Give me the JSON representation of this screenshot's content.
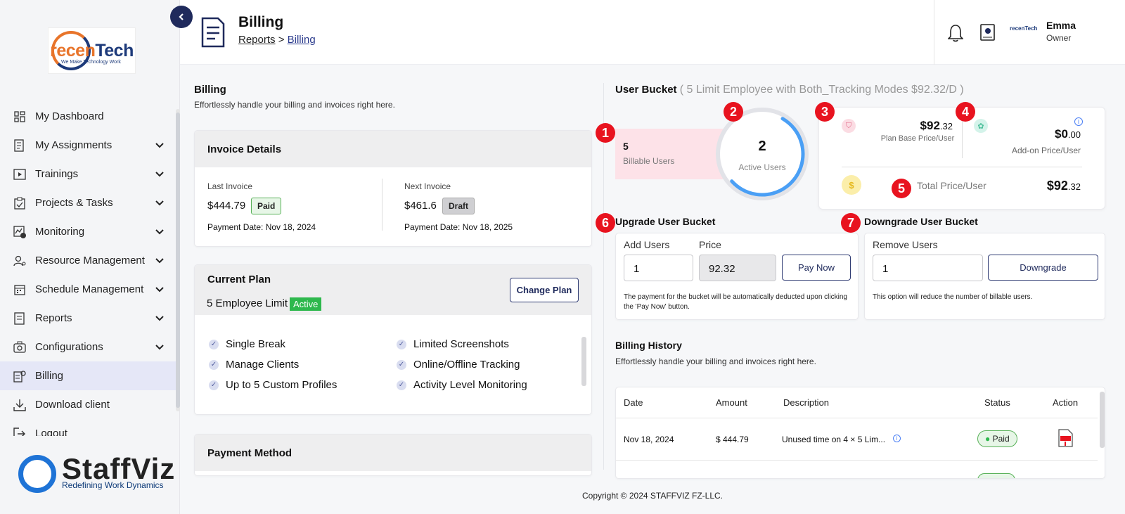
{
  "sidebar": {
    "brand": {
      "name_c": "recen",
      "name_t": "Tech",
      "tagline": "We Make Technology Work"
    },
    "items": [
      {
        "label": "My Dashboard",
        "icon": "dashboard-icon",
        "chevron": false
      },
      {
        "label": "My Assignments",
        "icon": "assignments-icon",
        "chevron": true
      },
      {
        "label": "Trainings",
        "icon": "play-icon",
        "chevron": true
      },
      {
        "label": "Projects & Tasks",
        "icon": "clipboard-icon",
        "chevron": true
      },
      {
        "label": "Monitoring",
        "icon": "monitor-icon",
        "chevron": true
      },
      {
        "label": "Resource Management",
        "icon": "user-gear-icon",
        "chevron": true
      },
      {
        "label": "Schedule Management",
        "icon": "calendar-icon",
        "chevron": true
      },
      {
        "label": "Reports",
        "icon": "report-icon",
        "chevron": true
      },
      {
        "label": "Configurations",
        "icon": "config-icon",
        "chevron": true
      },
      {
        "label": "Billing",
        "icon": "billing-icon",
        "chevron": false,
        "active": true
      },
      {
        "label": "Download client",
        "icon": "download-icon",
        "chevron": false
      },
      {
        "label": "Logout",
        "icon": "logout-icon",
        "chevron": false
      }
    ],
    "footer_brand": {
      "name": "StaffViz",
      "tagline": "Redefining Work Dynamics"
    }
  },
  "header": {
    "title": "Billing",
    "breadcrumb": [
      "Reports",
      "Billing"
    ],
    "user_name": "Emma",
    "user_role": "Owner",
    "avatar_text": "recenTech"
  },
  "billing": {
    "title": "Billing",
    "subtitle": "Effortlessly handle your billing and invoices right here."
  },
  "invoice": {
    "title": "Invoice Details",
    "last_label": "Last Invoice",
    "last_amount": "$444.79",
    "last_status": "Paid",
    "last_date": "Payment Date: Nov 18, 2024",
    "next_label": "Next Invoice",
    "next_amount": "$461.6",
    "next_status": "Draft",
    "next_date": "Payment Date: Nov 18, 2025"
  },
  "plan": {
    "title": "Current Plan",
    "name": "5 Employee Limit",
    "status": "Active",
    "change_label": "Change Plan",
    "features": [
      "Single Break",
      "Limited Screenshots",
      "Manage Clients",
      "Online/Offline Tracking",
      "Up to 5 Custom Profiles",
      "Activity Level Monitoring"
    ]
  },
  "payment_method": {
    "title": "Payment Method"
  },
  "bucket": {
    "title": "User Bucket",
    "subtitle": "( 5 Limit Employee with Both_Tracking Modes $92.32/D )",
    "billable_count": "5",
    "billable_label": "Billable Users",
    "active_count": "2",
    "active_label": "Active Users",
    "active_ratio": 0.55,
    "base_price_main": "$92",
    "base_price_dec": ".32",
    "base_price_label": "Plan Base Price/User",
    "addon_price_main": "$0",
    "addon_price_dec": ".00",
    "addon_price_label": "Add-on Price/User",
    "total_label": "Total Price/User",
    "total_main": "$92",
    "total_dec": ".32",
    "markers": [
      "1",
      "2",
      "3",
      "4",
      "5",
      "6",
      "7"
    ]
  },
  "upgrade": {
    "title": "Upgrade User Bucket",
    "add_label": "Add Users",
    "add_value": "1",
    "price_label": "Price",
    "price_value": "92.32",
    "pay_label": "Pay Now",
    "note": "The payment for the bucket will be automatically deducted upon clicking the 'Pay Now' button."
  },
  "downgrade": {
    "title": "Downgrade User Bucket",
    "remove_label": "Remove Users",
    "remove_value": "1",
    "button_label": "Downgrade",
    "note": "This option will reduce the number of billable users."
  },
  "history": {
    "title": "Billing History",
    "subtitle": "Effortlessly handle your billing and invoices right here.",
    "columns": [
      "Date",
      "Amount",
      "Description",
      "Status",
      "Action"
    ],
    "rows": [
      {
        "date": "Nov 18, 2024",
        "amount": "$ 444.79",
        "description": "Unused time on 4 × 5 Lim...",
        "status": "Paid"
      }
    ]
  },
  "footer": {
    "copyright": "Copyright © 2024 STAFFVIZ FZ-LLC."
  },
  "colors": {
    "accent": "#1f2a5c",
    "ring": "#4a9ff5",
    "pink": "#fde2e8",
    "marker": "#e8131f"
  }
}
